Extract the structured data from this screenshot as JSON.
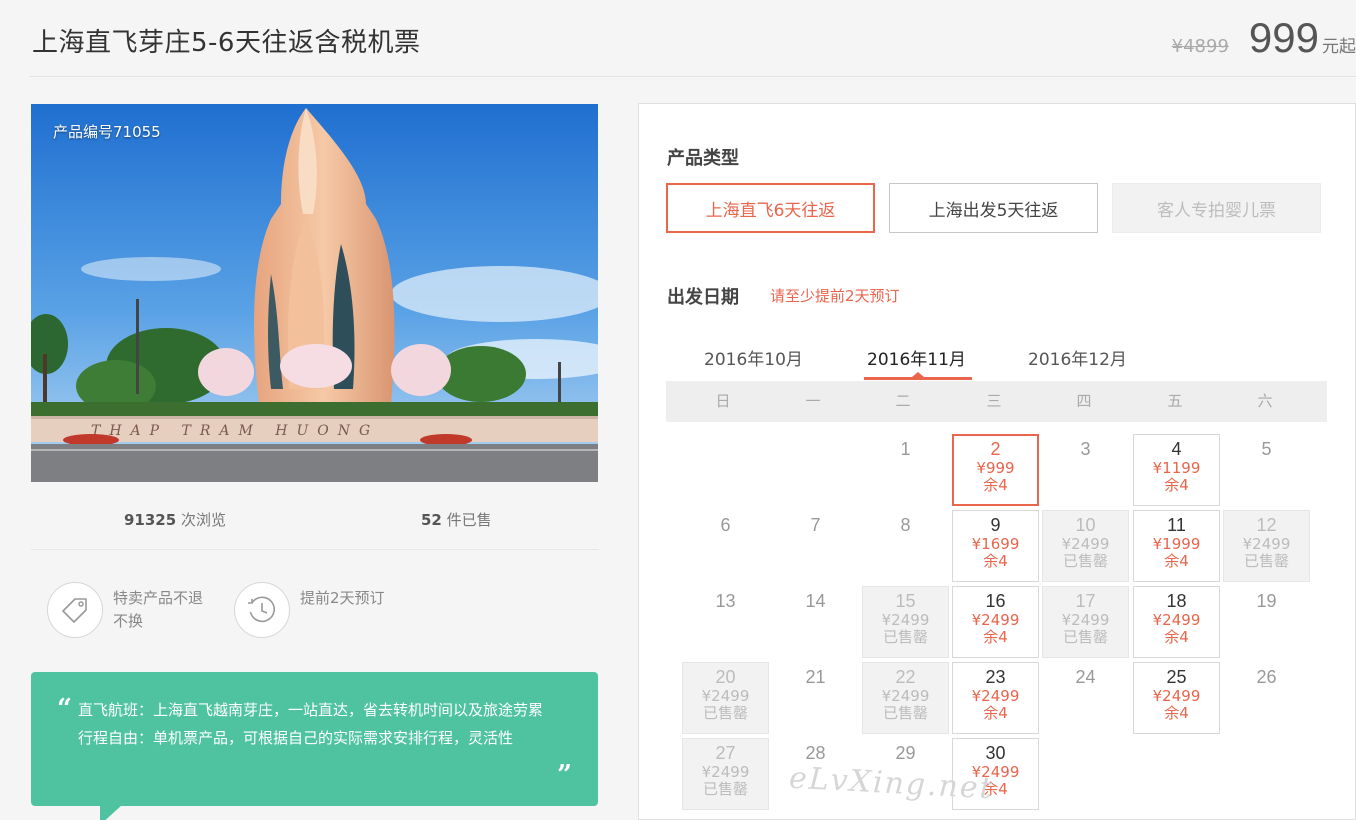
{
  "header": {
    "title": "上海直飞芽庄5-6天往返含税机票",
    "original_price": "¥4899",
    "price": "999",
    "price_unit": "元起"
  },
  "product": {
    "code_label": "产品编号71055",
    "views_count": "91325",
    "views_label": "次浏览",
    "sold_count": "52",
    "sold_label": "件已售"
  },
  "features": [
    {
      "icon": "tag-icon",
      "text": "特卖产品不退不换"
    },
    {
      "icon": "clock-icon",
      "text": "提前2天预订"
    }
  ],
  "description": {
    "line1": "直飞航班：上海直飞越南芽庄，一站直达，省去转机时间以及旅途劳累",
    "line2": "行程自由：单机票产品，可根据自己的实际需求安排行程，灵活性"
  },
  "booking": {
    "type_label": "产品类型",
    "types": [
      {
        "label": "上海直飞6天往返",
        "state": "selected"
      },
      {
        "label": "上海出发5天往返",
        "state": "normal"
      },
      {
        "label": "客人专拍婴儿票",
        "state": "disabled"
      }
    ],
    "date_label": "出发日期",
    "notice": "请至少提前2天预订",
    "months": [
      "2016年10月",
      "2016年11月",
      "2016年12月"
    ],
    "active_month": "2016年11月",
    "weekdays": [
      "日",
      "一",
      "二",
      "三",
      "四",
      "五",
      "六"
    ],
    "days": [
      {
        "day": "1",
        "state": "plain"
      },
      {
        "day": "2",
        "state": "selected",
        "price": "¥999",
        "stock": "余4"
      },
      {
        "day": "3",
        "state": "plain"
      },
      {
        "day": "4",
        "state": "available",
        "price": "¥1199",
        "stock": "余4"
      },
      {
        "day": "5",
        "state": "plain"
      },
      {
        "day": "6",
        "state": "plain"
      },
      {
        "day": "7",
        "state": "plain"
      },
      {
        "day": "8",
        "state": "plain"
      },
      {
        "day": "9",
        "state": "available",
        "price": "¥1699",
        "stock": "余4"
      },
      {
        "day": "10",
        "state": "soldout",
        "price": "¥2499",
        "stock": "已售罄"
      },
      {
        "day": "11",
        "state": "available",
        "price": "¥1999",
        "stock": "余4"
      },
      {
        "day": "12",
        "state": "soldout",
        "price": "¥2499",
        "stock": "已售罄"
      },
      {
        "day": "13",
        "state": "plain"
      },
      {
        "day": "14",
        "state": "plain"
      },
      {
        "day": "15",
        "state": "soldout",
        "price": "¥2499",
        "stock": "已售罄"
      },
      {
        "day": "16",
        "state": "available",
        "price": "¥2499",
        "stock": "余4"
      },
      {
        "day": "17",
        "state": "soldout",
        "price": "¥2499",
        "stock": "已售罄"
      },
      {
        "day": "18",
        "state": "available",
        "price": "¥2499",
        "stock": "余4"
      },
      {
        "day": "19",
        "state": "plain"
      },
      {
        "day": "20",
        "state": "soldout",
        "price": "¥2499",
        "stock": "已售罄"
      },
      {
        "day": "21",
        "state": "plain"
      },
      {
        "day": "22",
        "state": "soldout",
        "price": "¥2499",
        "stock": "已售罄"
      },
      {
        "day": "23",
        "state": "available",
        "price": "¥2499",
        "stock": "余4"
      },
      {
        "day": "24",
        "state": "plain"
      },
      {
        "day": "25",
        "state": "available",
        "price": "¥2499",
        "stock": "余4"
      },
      {
        "day": "26",
        "state": "plain"
      },
      {
        "day": "27",
        "state": "soldout",
        "price": "¥2499",
        "stock": "已售罄"
      },
      {
        "day": "28",
        "state": "plain"
      },
      {
        "day": "29",
        "state": "plain"
      },
      {
        "day": "30",
        "state": "available",
        "price": "¥2499",
        "stock": "余4"
      }
    ]
  },
  "watermark": "eLvXing.net",
  "colors": {
    "accent": "#e9654c",
    "green_panel": "#4fc3a0",
    "soldout_bg": "#f2f2f2"
  }
}
